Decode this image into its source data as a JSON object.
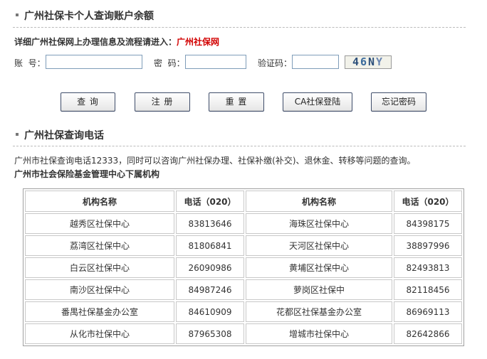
{
  "section1": {
    "title": "广州社保卡个人查询账户余额"
  },
  "intro": {
    "text": "详细广州社保网上办理信息及流程请进入：",
    "link": "广州社保网"
  },
  "form": {
    "account_label": "账  号：",
    "password_label": "密  码：",
    "captcha_label": "验证码：",
    "captcha_text": [
      "4",
      "6",
      "N",
      "Y"
    ]
  },
  "buttons": {
    "query": "查 询",
    "register": "注 册",
    "reset": "重 置",
    "ca_login": "CA社保登陆",
    "forgot": "忘记密码"
  },
  "section2": {
    "title": "广州社保查询电话"
  },
  "description": "广州市社保查询电话12333，同时可以咨询广州社保办理、社保补缴(补交)、退休金、转移等问题的查询。",
  "org_title": "广州市社会保险基金管理中心下属机构",
  "table": {
    "headers": [
      "机构名称",
      "电话（020）",
      "机构名称",
      "电话（020）"
    ],
    "rows": [
      [
        "越秀区社保中心",
        "83813646",
        "海珠区社保中心",
        "84398175"
      ],
      [
        "荔湾区社保中心",
        "81806841",
        "天河区社保中心",
        "38897996"
      ],
      [
        "白云区社保中心",
        "26090986",
        "黄埔区社保中心",
        "82493813"
      ],
      [
        "南沙区社保中心",
        "84987246",
        "萝岗区社保中",
        "82118456"
      ],
      [
        "番禺社保基金办公室",
        "84610909",
        "花都区社保基金办公室",
        "86969113"
      ],
      [
        "从化市社保中心",
        "87965308",
        "增城市社保中心",
        "82642866"
      ]
    ]
  }
}
